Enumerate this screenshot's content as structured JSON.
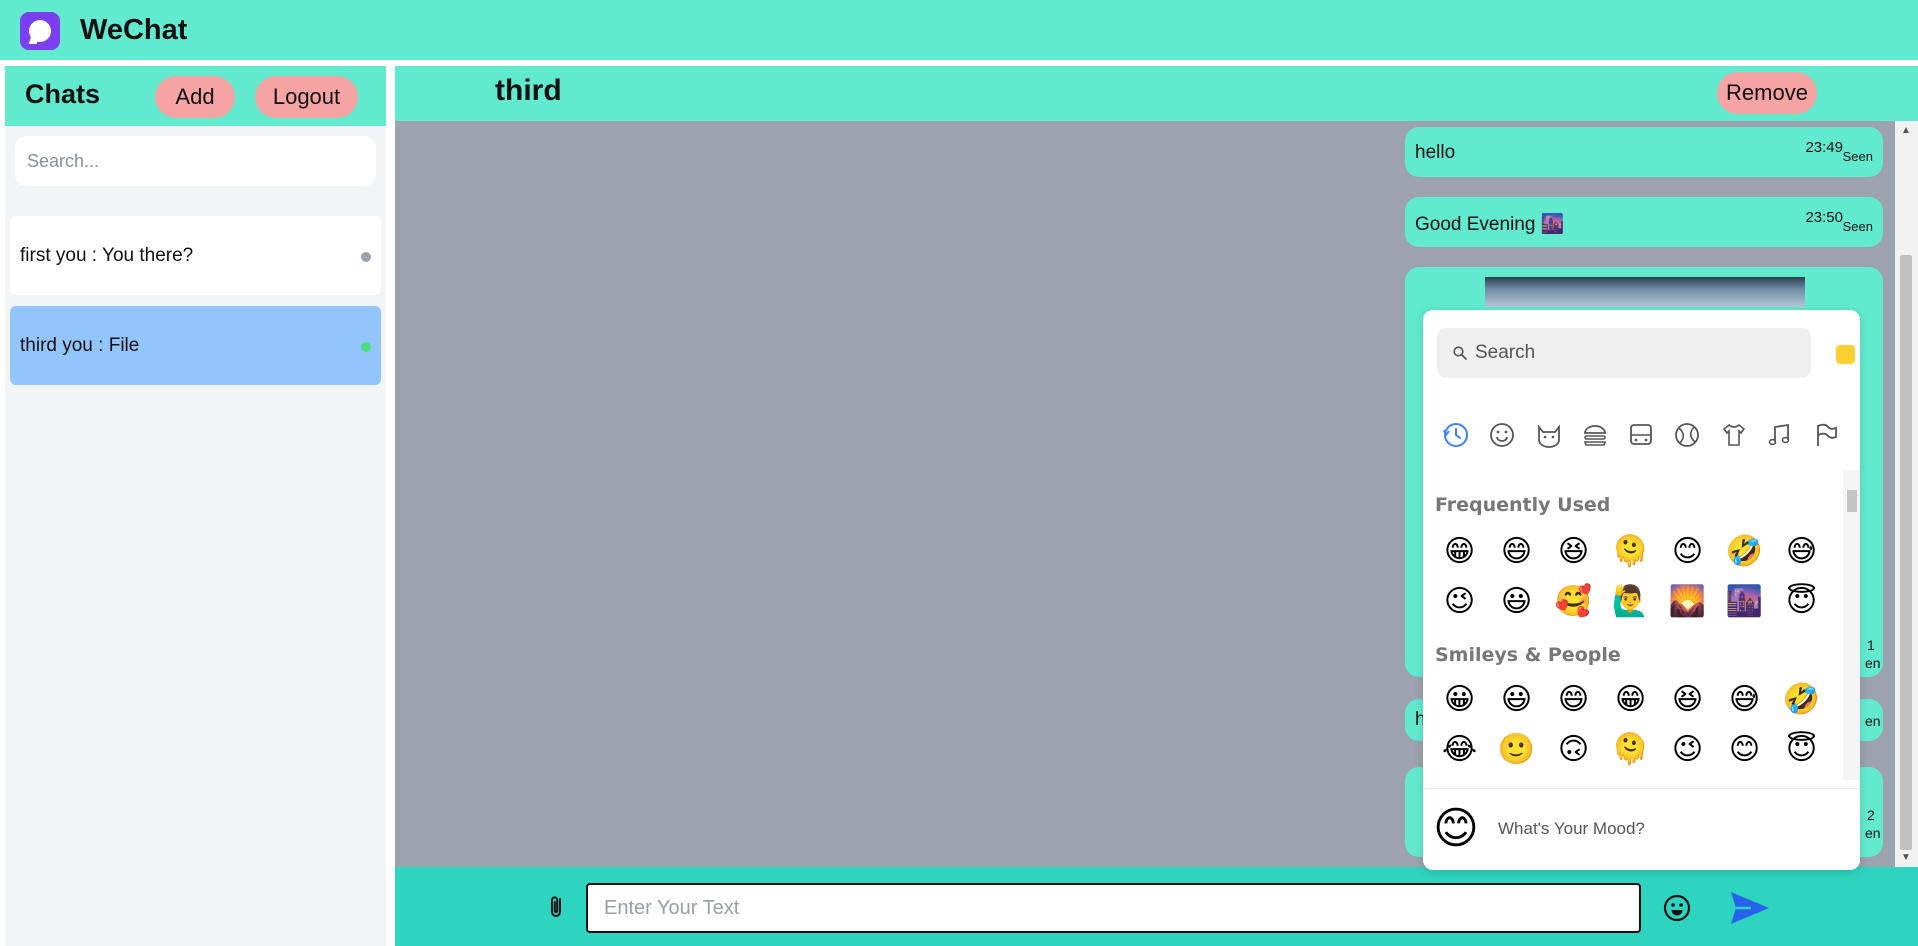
{
  "app": {
    "title": "WeChat"
  },
  "sidebar": {
    "title": "Chats",
    "add_label": "Add",
    "logout_label": "Logout",
    "search_placeholder": "Search...",
    "chats": [
      {
        "label": "first  you : You there?",
        "status_color": "#9ca3af"
      },
      {
        "label": "third  you : File",
        "status_color": "#4ade80"
      }
    ]
  },
  "conversation": {
    "contact_name": "third",
    "remove_label": "Remove",
    "messages": [
      {
        "text": "hello",
        "time": "23:49",
        "status": "Seen"
      },
      {
        "text": "Good Evening 🌆",
        "time": "23:50",
        "status": "Seen"
      },
      {
        "time_fragment": "1",
        "status_fragment": "en"
      },
      {
        "text_fragment": "h",
        "status_fragment": "en"
      },
      {
        "time_fragment": "2",
        "status_fragment": "en"
      }
    ]
  },
  "emoji_picker": {
    "search_placeholder": "Search",
    "skin_tone_color": "#ffcf33",
    "categories": [
      "clock-icon",
      "smiley-icon",
      "cat-icon",
      "burger-icon",
      "bus-icon",
      "ball-icon",
      "shirt-icon",
      "music-icon",
      "flag-icon"
    ],
    "sections": [
      {
        "title": "Frequently Used",
        "emojis": [
          "😁",
          "😄",
          "😆",
          "🫠",
          "😊",
          "🤣",
          "😅",
          "😉",
          "😃",
          "🥰",
          "🙋‍♂️",
          "🌄",
          "🌆",
          "😇"
        ]
      },
      {
        "title": "Smileys & People",
        "emojis": [
          "😀",
          "😃",
          "😄",
          "😁",
          "😆",
          "😅",
          "🤣",
          "😂",
          "🙂",
          "🙃",
          "🫠",
          "😉",
          "😊",
          "😇"
        ]
      }
    ],
    "footer_emoji": "😊",
    "footer_text": "What's Your Mood?"
  },
  "composer": {
    "placeholder": "Enter Your Text",
    "accent": "#2563eb"
  }
}
